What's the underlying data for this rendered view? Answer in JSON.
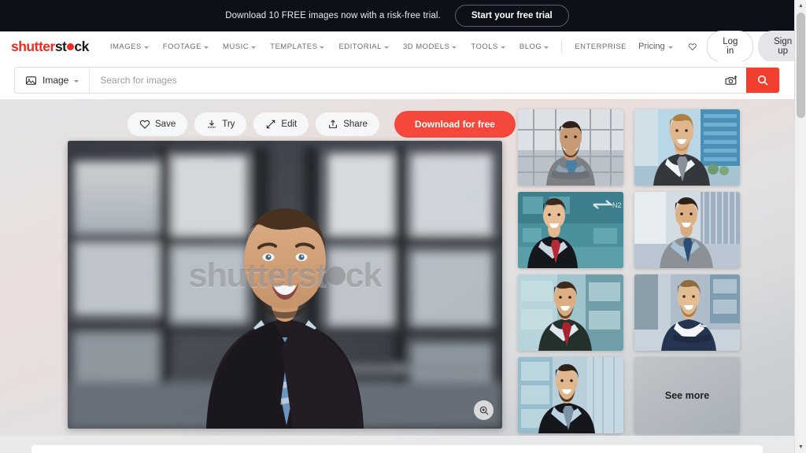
{
  "promo": {
    "text": "Download 10 FREE images now with a risk-free trial.",
    "cta_label": "Start your free trial"
  },
  "brand": {
    "name_part1": "shutter",
    "name_part2": "st",
    "name_part3": "ck",
    "red": "#ee2b24",
    "dark": "#1c1c1c"
  },
  "nav": {
    "items": [
      {
        "label": "IMAGES",
        "has_caret": true
      },
      {
        "label": "FOOTAGE",
        "has_caret": true
      },
      {
        "label": "MUSIC",
        "has_caret": true
      },
      {
        "label": "TEMPLATES",
        "has_caret": true
      },
      {
        "label": "EDITORIAL",
        "has_caret": true
      },
      {
        "label": "3D MODELS",
        "has_caret": true
      },
      {
        "label": "TOOLS",
        "has_caret": true
      },
      {
        "label": "BLOG",
        "has_caret": true
      }
    ],
    "enterprise_label": "ENTERPRISE",
    "pricing_label": "Pricing",
    "favorites_icon": "heart-icon",
    "login_label": "Log in",
    "signup_label": "Sign up"
  },
  "search": {
    "type_label": "Image",
    "type_icon": "image-icon",
    "placeholder": "Search for images",
    "value": "",
    "camera_icon": "camera-search-icon",
    "search_icon": "search-icon",
    "accent": "#f03e2f"
  },
  "toolbar": {
    "save_label": "Save",
    "save_icon": "heart-icon",
    "try_label": "Try",
    "try_icon": "download-try-icon",
    "edit_label": "Edit",
    "edit_icon": "edit-wand-icon",
    "share_label": "Share",
    "share_icon": "share-upload-icon",
    "download_label": "Download for free",
    "download_color": "#f4483c"
  },
  "hero": {
    "watermark_text_left": "shutterst",
    "watermark_text_right": "ck",
    "zoom_icon": "magnifier-plus-icon",
    "alt": "Smiling businessman in dark suit and striped blue tie, blurred office interior"
  },
  "related": {
    "thumbnails": [
      {
        "alt": "Bearded businessman in grey suit, arms crossed, glass office facade"
      },
      {
        "alt": "Blond businessman smiling in dark suit and grey tie, city towers behind"
      },
      {
        "alt": "Young businessman in black suit with red tie, arms crossed, glass building"
      },
      {
        "alt": "Businessman in grey suit with navy tie, arms crossed, modern lobby"
      },
      {
        "alt": "Bearded man in dark green suit with red tie, arms crossed, teal glass"
      },
      {
        "alt": "Businessman in navy blazer and white shirt, arms crossed, office corridor"
      },
      {
        "alt": "Businessman in black suit and light blue shirt, glass office background"
      }
    ],
    "see_more_label": "See more"
  },
  "scrollbar": {
    "up_arrow": "scroll-up-icon",
    "down_arrow": "scroll-down-icon"
  }
}
